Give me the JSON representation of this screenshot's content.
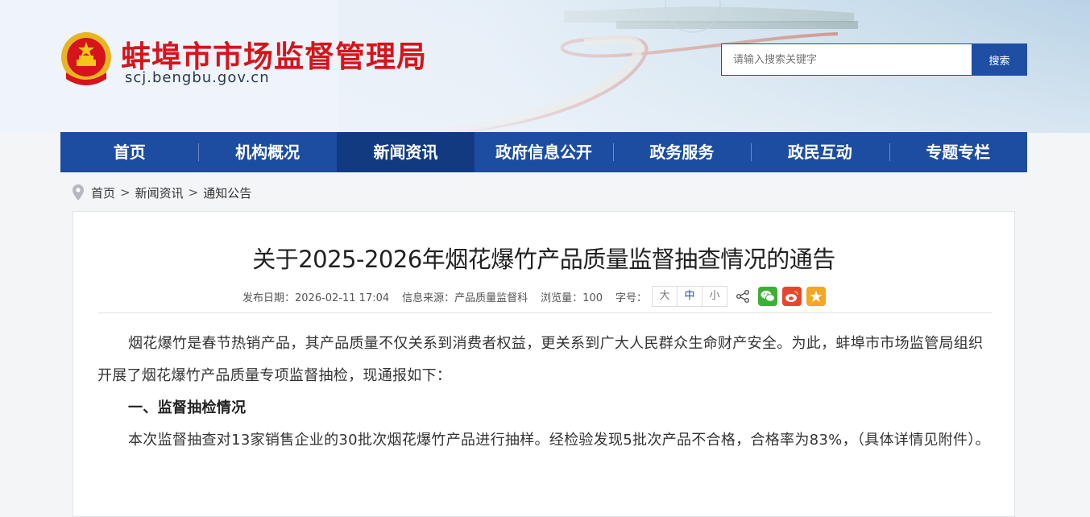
{
  "header": {
    "site_title": "蚌埠市市场监督管理局",
    "site_url": "scj.bengbu.gov.cn",
    "search_placeholder": "请输入搜索关键字",
    "search_button": "搜索",
    "brand_color": "#d5141c",
    "nav_color": "#1c4da1"
  },
  "nav": {
    "items": [
      "首页",
      "机构概况",
      "新闻资讯",
      "政府信息公开",
      "政务服务",
      "政民互动",
      "专题专栏"
    ],
    "active": "新闻资讯"
  },
  "breadcrumb": {
    "items": [
      "首页",
      "新闻资讯",
      "通知公告"
    ],
    "separator": ">"
  },
  "article": {
    "title": "关于2025-2026年烟花爆竹产品质量监督抽查情况的通告",
    "meta": {
      "date": "发布日期：2026-02-11 17:04",
      "source": "信息来源：产品质量监督科",
      "views": "浏览量：100",
      "font_size_label": "字号：",
      "font_sizes": [
        "大",
        "中",
        "小"
      ],
      "font_size_selected": "中"
    },
    "share_icons": [
      "share-icon",
      "wechat-icon",
      "weibo-icon",
      "favorite-icon"
    ],
    "paragraphs": {
      "p1": "烟花爆竹是春节热销产品，其产品质量不仅关系到消费者权益，更关系到广大人民群众生命财产安全。为此，蚌埠市市场监管局组织开展了烟花爆竹产品质量专项监督抽检，现通报如下：",
      "h1": "一、监督抽检情况",
      "p2": "本次监督抽查对13家销售企业的30批次烟花爆竹产品进行抽样。经检验发现5批次产品不合格，合格率为83%，（具体详情见附件）。"
    }
  }
}
